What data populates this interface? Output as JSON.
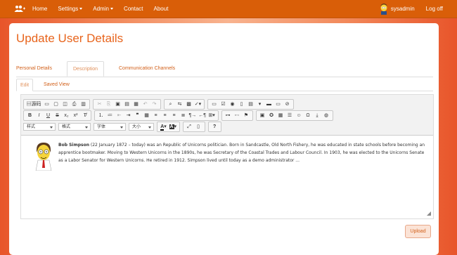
{
  "nav": {
    "brand_icon": "users-icon",
    "items": [
      {
        "label": "Home"
      },
      {
        "label": "Settings"
      },
      {
        "label": "Admin"
      },
      {
        "label": "Contact"
      },
      {
        "label": "About"
      }
    ],
    "user": "sysadmin",
    "logoff": "Log off"
  },
  "page": {
    "title": "Update User Details"
  },
  "tabs": [
    {
      "label": "Personal Details"
    },
    {
      "label": "Description",
      "active": true
    },
    {
      "label": "Communication Channels"
    }
  ],
  "subtabs": [
    {
      "label": "Edit",
      "active": true
    },
    {
      "label": "Saved View"
    }
  ],
  "editor": {
    "toolbar": {
      "source_label": "源码",
      "format_combos": [
        "样式",
        "格式",
        "字体",
        "大小"
      ]
    },
    "content": {
      "name": "Bob Simpson",
      "text": " (22 January 1872 – today) was an Republic of Unicorns politician. Born in Sandcastle, Old North Fishery, he was educated in state schools before becoming an apprentice bootmaker. Moving to Western Unicorns in the 1890s, he was Secretary of the Coastal Trades and Labour Council. In 1903, he was elected to the Unicorns Senate as a Labor Senator for Western Unicorns. He retired in 1912. Simpson lived until today as a demo administrator ..."
    }
  },
  "upload_label": "Upload",
  "colors": {
    "navbar": "#d95e08",
    "accent": "#e8641c",
    "link": "#d2601a"
  }
}
